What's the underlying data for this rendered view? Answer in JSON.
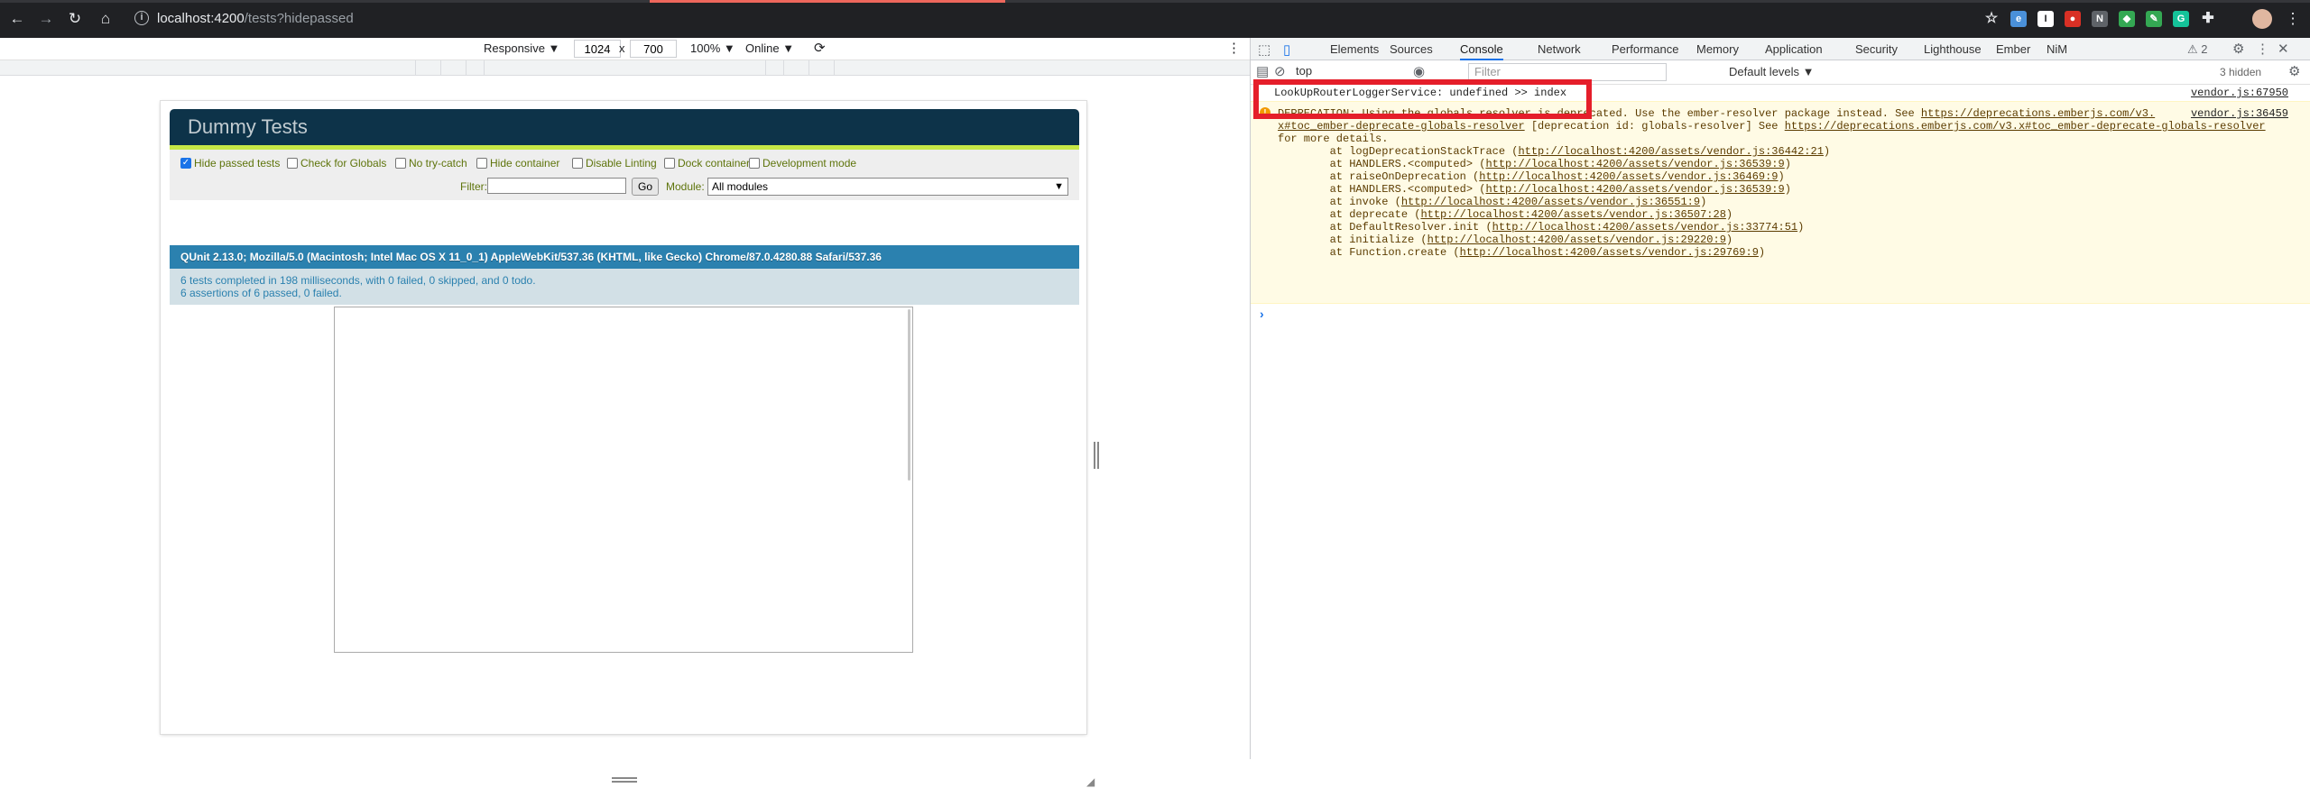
{
  "browser": {
    "url_host": "localhost:4200",
    "url_path": "/tests?hidepassed",
    "nav": [
      "←",
      "→",
      "↻",
      "⌂"
    ],
    "info_icon": "i",
    "extensions": [
      {
        "name": "bookmark-star-icon",
        "label": "☆",
        "color": "#e8eaed"
      },
      {
        "name": "ember-inspector-icon",
        "label": "e",
        "color": "#4a90d9"
      },
      {
        "name": "instapaper-icon",
        "label": "I",
        "color": "#ffffff"
      },
      {
        "name": "extension-red-icon",
        "label": "●",
        "color": "#d93025"
      },
      {
        "name": "extension-n-icon",
        "label": "N",
        "color": "#5f6368"
      },
      {
        "name": "extension-shield-icon",
        "label": "◆",
        "color": "#34a853"
      },
      {
        "name": "extension-leaf-icon",
        "label": "✎",
        "color": "#34a853"
      },
      {
        "name": "grammarly-icon",
        "label": "G",
        "color": "#15c39a"
      },
      {
        "name": "extensions-puzzle-icon",
        "label": "✚",
        "color": "#e8eaed"
      }
    ],
    "menu": "⋮"
  },
  "device_toolbar": {
    "mode": "Responsive ▼",
    "width": "1024",
    "times": "x",
    "height": "700",
    "zoom": "100% ▼",
    "network": "Online ▼",
    "rotate": "⟳",
    "more": "⋮"
  },
  "qunit": {
    "title": "Dummy Tests",
    "options": [
      {
        "label": "Hide passed tests",
        "checked": true
      },
      {
        "label": "Check for Globals",
        "checked": false
      },
      {
        "label": "No try-catch",
        "checked": false
      },
      {
        "label": "Hide container",
        "checked": false
      },
      {
        "label": "Disable Linting",
        "checked": false
      },
      {
        "label": "Dock container",
        "checked": false
      },
      {
        "label": "Development mode",
        "checked": false
      }
    ],
    "filter_label": "Filter:",
    "filter_value": "",
    "go_label": "Go",
    "module_label": "Module:",
    "module_value": "All modules",
    "module_arrow": "▼",
    "user_agent": "QUnit 2.13.0; Mozilla/5.0 (Macintosh; Intel Mac OS X 11_0_1) AppleWebKit/537.36 (KHTML, like Gecko) Chrome/87.0.4280.88 Safari/537.36",
    "status_line1": "6 tests completed in 198 milliseconds, with 0 failed, 0 skipped, and 0 todo.",
    "status_line2": "6 assertions of 6 passed, 0 failed."
  },
  "devtools": {
    "tabs": [
      "Elements",
      "Sources",
      "Console",
      "Network",
      "Performance",
      "Memory",
      "Application",
      "Security",
      "Lighthouse",
      "Ember",
      "NiM"
    ],
    "selected_tab": "Console",
    "issues_count": "⚠ 2",
    "context": "top",
    "filter_placeholder": "Filter",
    "levels": "Default levels ▼",
    "hidden": "3 hidden",
    "log_message": "LookUpRouterLoggerService: undefined >> index",
    "log_source": "vendor.js:67950",
    "warn_source": "vendor.js:36459",
    "warn_lines": [
      {
        "pre": "DEPRECATION: Using the globals resolver is deprecated. Use the ember-resolver package instead. See ",
        "link": "https://deprecations.emberjs.com/v3.",
        "post": ""
      },
      {
        "pre": "",
        "link": "x#toc_ember-deprecate-globals-resolver",
        "post": " [deprecation id: globals-resolver] See ",
        "link2": "https://deprecations.emberjs.com/v3.x#toc_ember-deprecate-globals-resolver"
      },
      {
        "pre": "for more details.",
        "link": "",
        "post": ""
      },
      {
        "pre": "        at logDeprecationStackTrace (",
        "link": "http://localhost:4200/assets/vendor.js:36442:21",
        "post": ")"
      },
      {
        "pre": "        at HANDLERS.<computed> (",
        "link": "http://localhost:4200/assets/vendor.js:36539:9",
        "post": ")"
      },
      {
        "pre": "        at raiseOnDeprecation (",
        "link": "http://localhost:4200/assets/vendor.js:36469:9",
        "post": ")"
      },
      {
        "pre": "        at HANDLERS.<computed> (",
        "link": "http://localhost:4200/assets/vendor.js:36539:9",
        "post": ")"
      },
      {
        "pre": "        at invoke (",
        "link": "http://localhost:4200/assets/vendor.js:36551:9",
        "post": ")"
      },
      {
        "pre": "        at deprecate (",
        "link": "http://localhost:4200/assets/vendor.js:36507:28",
        "post": ")"
      },
      {
        "pre": "        at DefaultResolver.init (",
        "link": "http://localhost:4200/assets/vendor.js:33774:51",
        "post": ")"
      },
      {
        "pre": "        at initialize (",
        "link": "http://localhost:4200/assets/vendor.js:29220:9",
        "post": ")"
      },
      {
        "pre": "        at Function.create (",
        "link": "http://localhost:4200/assets/vendor.js:29769:9",
        "post": ")"
      }
    ],
    "prompt": "›"
  }
}
